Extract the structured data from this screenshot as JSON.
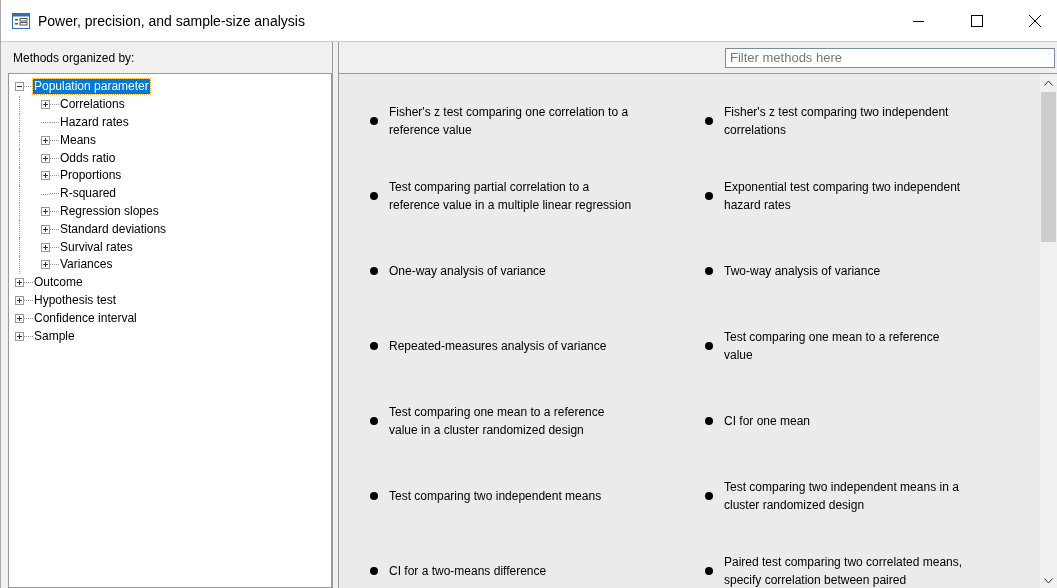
{
  "window": {
    "title": "Power, precision, and sample-size analysis"
  },
  "sidebar": {
    "heading": "Methods organized by:",
    "tree": [
      {
        "label": "Population parameter",
        "kind": "expandable",
        "expanded": true,
        "selected": true,
        "children": [
          {
            "label": "Correlations",
            "kind": "expandable",
            "expanded": false,
            "selected": false
          },
          {
            "label": "Hazard rates",
            "kind": "leaf",
            "selected": false
          },
          {
            "label": "Means",
            "kind": "expandable",
            "expanded": false,
            "selected": false
          },
          {
            "label": "Odds ratio",
            "kind": "expandable",
            "expanded": false,
            "selected": false
          },
          {
            "label": "Proportions",
            "kind": "expandable",
            "expanded": false,
            "selected": false
          },
          {
            "label": "R-squared",
            "kind": "leaf",
            "selected": false
          },
          {
            "label": "Regression slopes",
            "kind": "expandable",
            "expanded": false,
            "selected": false
          },
          {
            "label": "Standard deviations",
            "kind": "expandable",
            "expanded": false,
            "selected": false
          },
          {
            "label": "Survival rates",
            "kind": "expandable",
            "expanded": false,
            "selected": false
          },
          {
            "label": "Variances",
            "kind": "expandable",
            "expanded": false,
            "selected": false
          }
        ]
      },
      {
        "label": "Outcome",
        "kind": "expandable",
        "expanded": false,
        "selected": false
      },
      {
        "label": "Hypothesis test",
        "kind": "expandable",
        "expanded": false,
        "selected": false
      },
      {
        "label": "Confidence interval",
        "kind": "expandable",
        "expanded": false,
        "selected": false
      },
      {
        "label": "Sample",
        "kind": "expandable",
        "expanded": false,
        "selected": false
      }
    ]
  },
  "filter": {
    "placeholder": "Filter methods here"
  },
  "method_rows": [
    [
      "Fisher's z test comparing one correlation to a reference value",
      "Fisher's z test comparing two independent correlations"
    ],
    [
      "Test comparing partial correlation to a reference value in a multiple linear regression",
      "Exponential test comparing two independent hazard rates"
    ],
    [
      "One-way analysis of variance",
      "Two-way analysis of variance"
    ],
    [
      "Repeated-measures analysis of variance",
      "Test comparing one mean to a reference value"
    ],
    [
      "Test comparing one mean to a reference value in a cluster randomized design",
      "CI for one mean"
    ],
    [
      "Test comparing two independent means",
      "Test comparing two independent means in a cluster randomized design"
    ],
    [
      "CI for a two-means difference",
      "Paired test comparing two correlated means, specify correlation between paired"
    ]
  ]
}
